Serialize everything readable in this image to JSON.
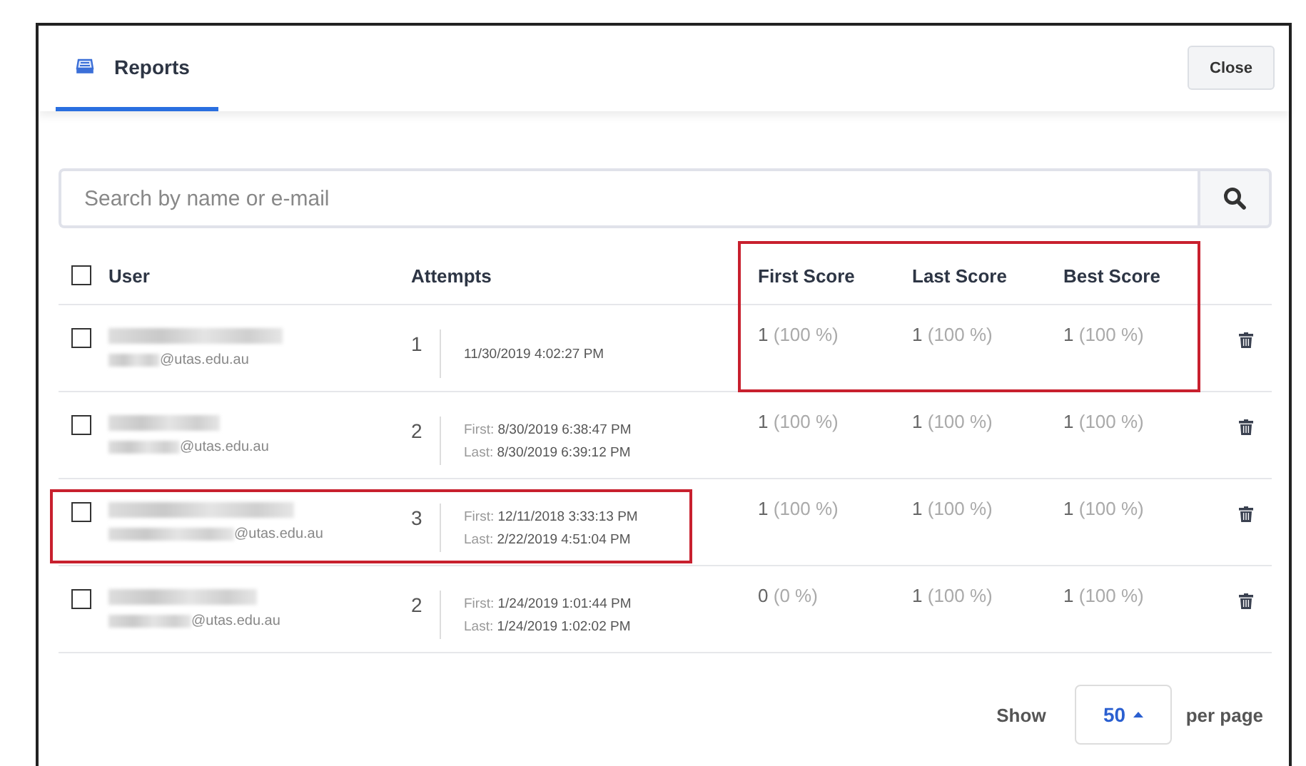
{
  "header": {
    "tabs": [
      {
        "label": "Reports",
        "selected": true
      }
    ],
    "close_button": "Close"
  },
  "search": {
    "placeholder": "Search by name or e-mail"
  },
  "table": {
    "select_all_checked": false,
    "scores_highlighted": true,
    "columns": [
      "User",
      "Attempts",
      "First Score",
      "Last Score",
      "Best Score"
    ],
    "rows": [
      {
        "checked": false,
        "highlighted": false,
        "email_domain": "@utas.edu.au",
        "attempts": "1",
        "dates": [
          {
            "value": "11/30/2019 4:02:27 PM"
          }
        ],
        "scores": [
          {
            "value": "1",
            "percent": "(100 %)"
          },
          {
            "value": "1",
            "percent": "(100 %)"
          },
          {
            "value": "1",
            "percent": "(100 %)"
          }
        ]
      },
      {
        "checked": false,
        "highlighted": false,
        "email_domain": "@utas.edu.au",
        "attempts": "2",
        "dates": [
          {
            "label": "First:",
            "value": "8/30/2019 6:38:47 PM"
          },
          {
            "label": "Last:",
            "value": "8/30/2019 6:39:12 PM"
          }
        ],
        "scores": [
          {
            "value": "1",
            "percent": "(100 %)"
          },
          {
            "value": "1",
            "percent": "(100 %)"
          },
          {
            "value": "1",
            "percent": "(100 %)"
          }
        ]
      },
      {
        "checked": false,
        "highlighted": true,
        "email_domain": "@utas.edu.au",
        "attempts": "3",
        "dates": [
          {
            "label": "First:",
            "value": "12/11/2018 3:33:13 PM"
          },
          {
            "label": "Last:",
            "value": "2/22/2019 4:51:04 PM"
          }
        ],
        "scores": [
          {
            "value": "1",
            "percent": "(100 %)"
          },
          {
            "value": "1",
            "percent": "(100 %)"
          },
          {
            "value": "1",
            "percent": "(100 %)"
          }
        ]
      },
      {
        "checked": false,
        "highlighted": false,
        "email_domain": "@utas.edu.au",
        "attempts": "2",
        "dates": [
          {
            "label": "First:",
            "value": "1/24/2019 1:01:44 PM"
          },
          {
            "label": "Last:",
            "value": "1/24/2019 1:02:02 PM"
          }
        ],
        "scores": [
          {
            "value": "0",
            "percent": "(0 %)"
          },
          {
            "value": "1",
            "percent": "(100 %)"
          },
          {
            "value": "1",
            "percent": "(100 %)"
          }
        ]
      }
    ]
  },
  "pagination": {
    "show_label": "Show",
    "page_size": "50",
    "per_page_label": "per page"
  }
}
